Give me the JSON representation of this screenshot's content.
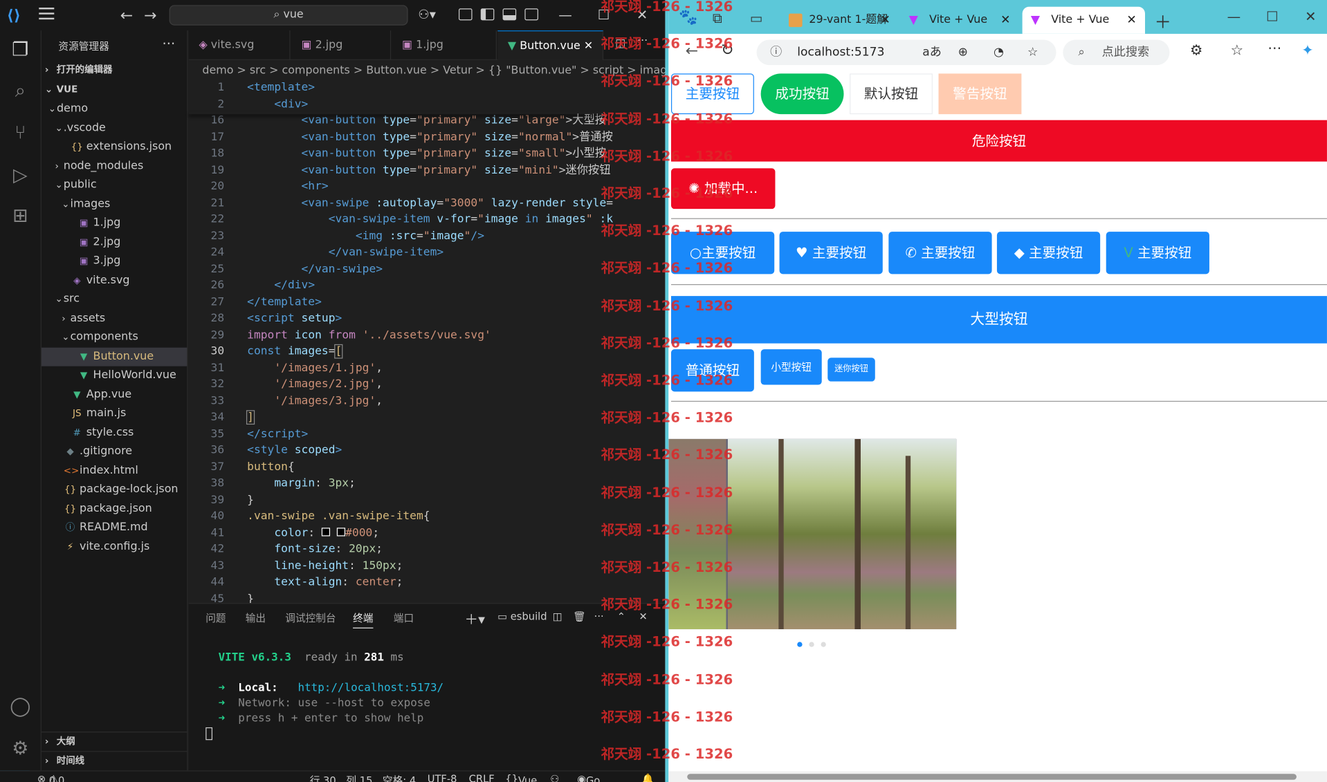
{
  "vscode": {
    "search_text": "vue",
    "sidebar_title": "资源管理器",
    "open_editors": "打开的编辑器",
    "root": "VUE",
    "tree": [
      "demo",
      ".vscode",
      "extensions.json",
      "node_modules",
      "public",
      "images",
      "1.jpg",
      "2.jpg",
      "3.jpg",
      "vite.svg",
      "src",
      "assets",
      "components",
      "Button.vue",
      "HelloWorld.vue",
      "App.vue",
      "main.js",
      "style.css",
      ".gitignore",
      "index.html",
      "package-lock.json",
      "package.json",
      "README.md",
      "vite.config.js"
    ],
    "outline": "大纲",
    "timeline": "时间线",
    "tabs": [
      "vite.svg",
      "2.jpg",
      "1.jpg",
      "Button.vue"
    ],
    "breadcrumbs": "demo > src > components > Button.vue > Vetur > {} \"Button.vue\" > script > image",
    "line_numbers": [
      "1",
      "2",
      "16",
      "17",
      "18",
      "19",
      "20",
      "21",
      "22",
      "23",
      "24",
      "25",
      "26",
      "27",
      "28",
      "29",
      "30",
      "31",
      "32",
      "33",
      "34",
      "35",
      "36",
      "37",
      "38",
      "39",
      "40",
      "41",
      "42",
      "43",
      "44",
      "45"
    ],
    "panel_tabs": [
      "问题",
      "输出",
      "调试控制台",
      "终端",
      "端口"
    ],
    "terminal_name": "esbuild",
    "terminal": {
      "vite": "VITE v6.3.3",
      "ready": "ready in",
      "ms": "281",
      "ms_unit": "ms",
      "local_label": "Local:",
      "local_url": "http://localhost:5173/",
      "network": "Network: use --host to expose",
      "help": "press h + enter to show help"
    },
    "status": {
      "errors": "0",
      "warnings": "0",
      "position": "行 30，列 15",
      "spaces": "空格: 4",
      "encoding": "UTF-8",
      "eol": "CRLF",
      "lang": "Vue",
      "golive": "Go Live"
    }
  },
  "watermark": "祁天翊 -126 - 1326",
  "browser": {
    "tabs": [
      "29-vant 1-题解",
      "Vite + Vue",
      "Vite + Vue"
    ],
    "url": "localhost:5173",
    "search_placeholder": "点此搜索",
    "buttons_row1": [
      "主要按钮",
      "成功按钮",
      "默认按钮",
      "警告按钮"
    ],
    "danger": "危险按钮",
    "loading": "加载中...",
    "icon_buttons": [
      "主要按钮",
      "主要按钮",
      "主要按钮",
      "主要按钮",
      "主要按钮"
    ],
    "large": "大型按钮",
    "normal": "普通按钮",
    "small": "小型按钮",
    "mini": "迷你按钮"
  },
  "colors": {
    "primary": "#1989fa",
    "success": "#07c160",
    "danger": "#ee0a24",
    "warning": "#ffcbb0"
  }
}
